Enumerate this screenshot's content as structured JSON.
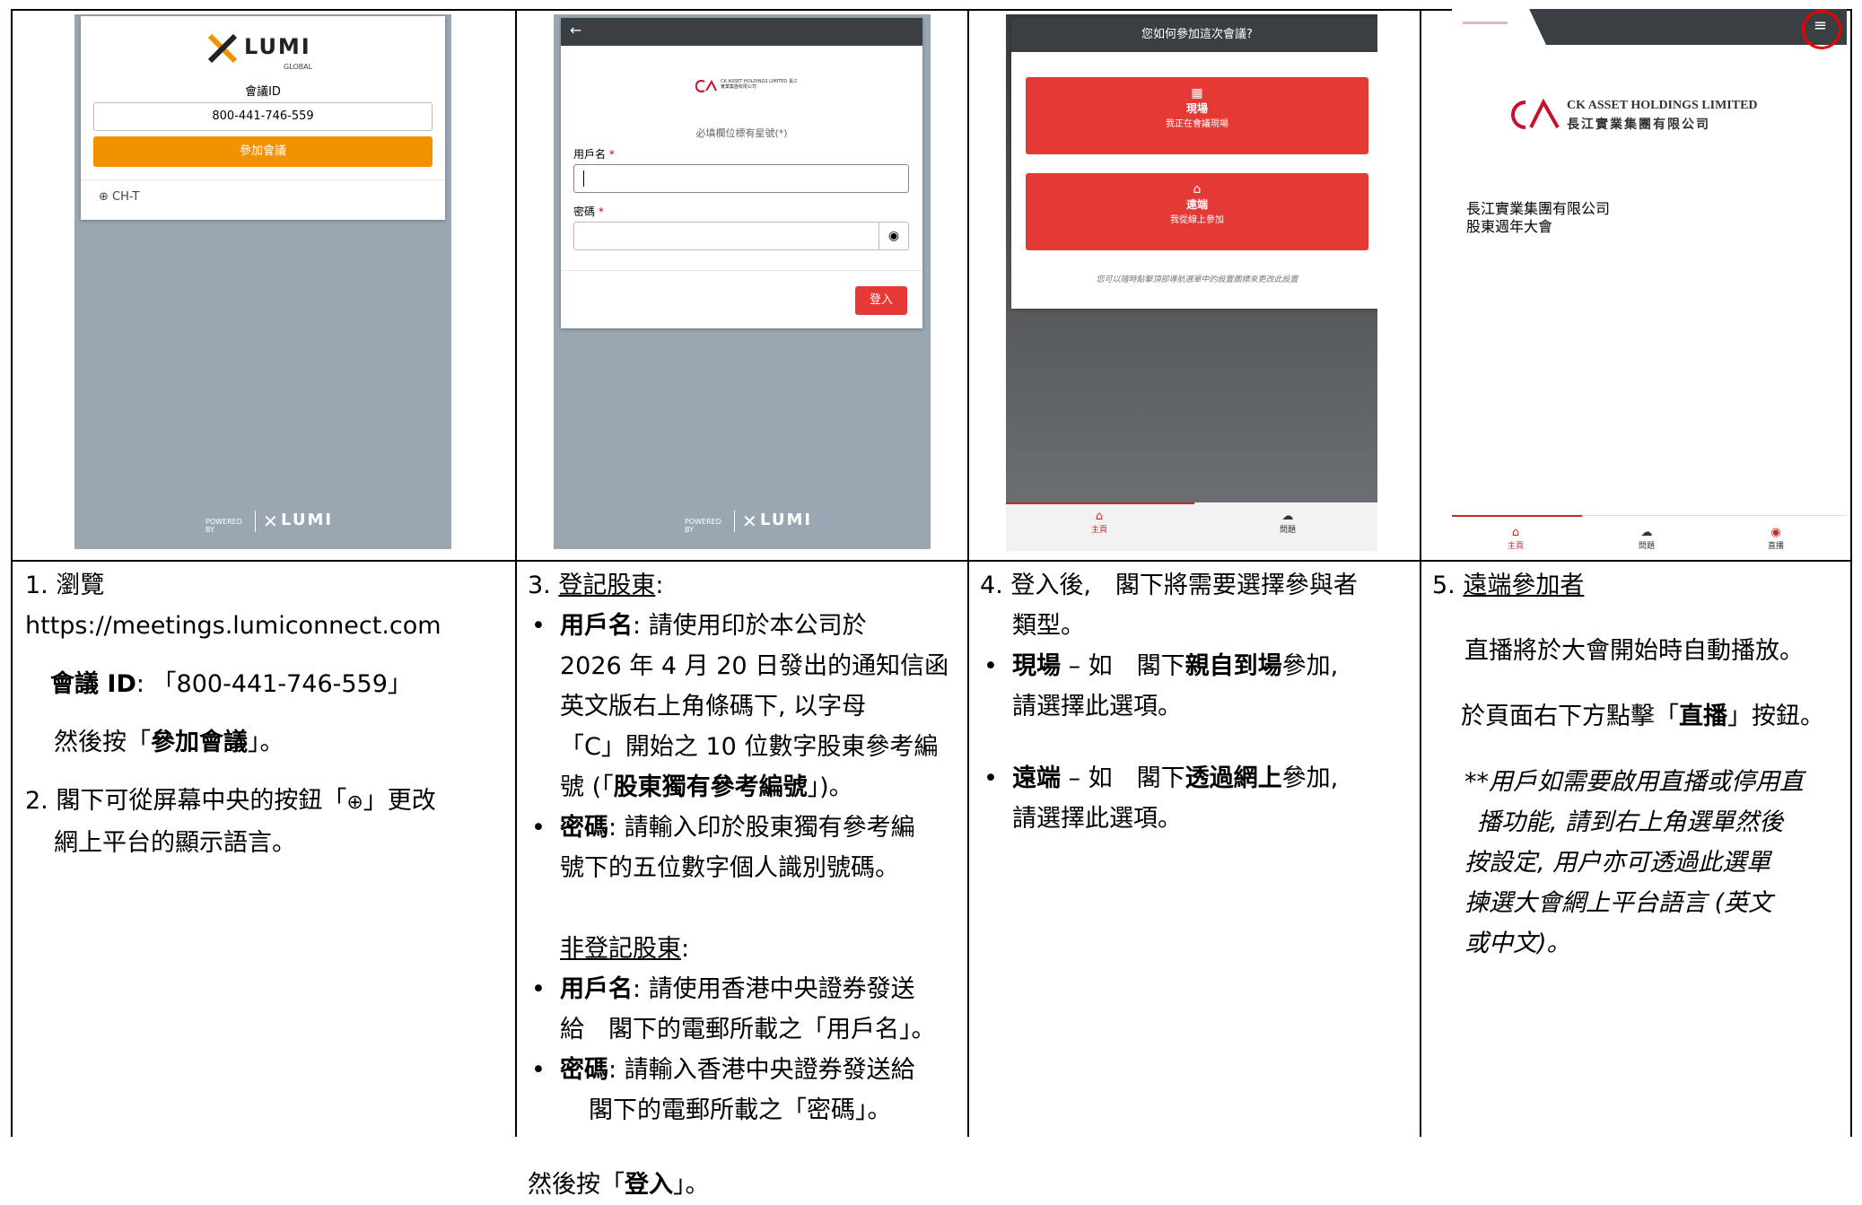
{
  "shot1": {
    "meeting_id_label": "會議ID",
    "meeting_id_value": "800-441-746-559",
    "join_button": "參加會議",
    "lang": "CH-T",
    "brand": "LUMI",
    "brand_sub": "GLOBAL",
    "powered_by": "POWERED BY",
    "colors": {
      "accent": "#f39200",
      "bg": "#9aa6b2"
    }
  },
  "shot2": {
    "back_icon": "←",
    "logo_text": "CK ASSET HOLDINGS LIMITED 長江實業集團有限公司",
    "required_note": "必填欄位標有星號(*)",
    "username_label": "用戶名",
    "password_label": "密碼",
    "login_button": "登入",
    "brand": "LUMI",
    "brand_sub": "GLOBAL",
    "powered_by": "POWERED BY"
  },
  "shot3": {
    "header": "您如何參加這次會議?",
    "option1_title": "現場",
    "option1_sub": "我正在會議現場",
    "option2_title": "遠端",
    "option2_sub": "我從線上參加",
    "footnote": "您可以隨時點擊頂部導航選單中的設置圖標來更改此設置",
    "tab_home": "主頁",
    "tab_questions": "問題"
  },
  "shot4": {
    "company_en": "CK ASSET HOLDINGS LIMITED",
    "company_zh": "長江實業集團有限公司",
    "title_line1": "長江實業集團有限公司",
    "title_line2": "股東週年大會",
    "menu_icon": "≡",
    "tab_home": "主頁",
    "tab_questions": "問題",
    "tab_live": "直播"
  },
  "col1": {
    "step1_prefix": "1. 瀏覽 ",
    "url": "https://meetings.lumiconnect.com",
    "id_label": "會議 ID",
    "id_value": ": 「800-441-746-559」",
    "then_prefix": "然後按「",
    "then_bold": "參加會議",
    "then_suffix": "」。",
    "step2_a": "2. 閣下可從屏幕中央的按鈕「",
    "step2_b": "」更改",
    "step2_line2": "網上平台的顯示語言。"
  },
  "col2": {
    "step3_num": "3. ",
    "registered": "登記股東",
    "colon": ":",
    "b1_label": "用戶名",
    "b1_l1": ": 請使用印於本公司於",
    "b1_l2": "2026 年 4 月 20 日發出的通知信函",
    "b1_l3": "英文版右上角條碼下, 以字母",
    "b1_l4": "「C」開始之 10 位數字股東參考編",
    "b1_l5a": "號 (「",
    "b1_l5b": "股東獨有參考編號",
    "b1_l5c": "」)。",
    "b2_label": "密碼",
    "b2_l1": ": 請輸入印於股東獨有參考編",
    "b2_l2": "號下的五位數字個人識別號碼。",
    "non_registered": "非登記股東",
    "b3_label": "用戶名",
    "b3_l1": ": 請使用香港中央證券發送",
    "b3_l2": "給　閣下的電郵所載之「用戶名」。",
    "b4_label": "密碼",
    "b4_l1": ": 請輸入香港中央證券發送給",
    "b4_l2": "閣下的電郵所載之「密碼」。",
    "then_prefix": "然後按「",
    "then_bold": "登入",
    "then_suffix": "」。"
  },
  "col3": {
    "step4_l1": "4. 登入後,　閣下將需要選擇參與者",
    "step4_l2": "類型。",
    "opt1_label": "現場",
    "opt1_a": " – 如　閣下",
    "opt1_bold": "親自到場",
    "opt1_b": "參加,",
    "opt1_l2": "請選擇此選項。",
    "opt2_label": "遠端",
    "opt2_a": " – 如　閣下",
    "opt2_bold": "透過網上",
    "opt2_b": "參加,",
    "opt2_l2": "請選擇此選項。"
  },
  "col4": {
    "step5_num": "5. ",
    "step5_title": "遠端參加者",
    "p1": "直播將於大會開始時自動播放。",
    "p2_a": "於頁面右下方點擊「",
    "p2_bold": "直播",
    "p2_b": "」按鈕。",
    "note_l1": "**用戶如需要啟用直播或停用直",
    "note_l2": "播功能, 請到右上角選單然後",
    "note_l3": "按設定, 用户亦可透過此選單",
    "note_l4": "揀選大會網上平台語言 (英文",
    "note_l5": "或中文)。"
  }
}
